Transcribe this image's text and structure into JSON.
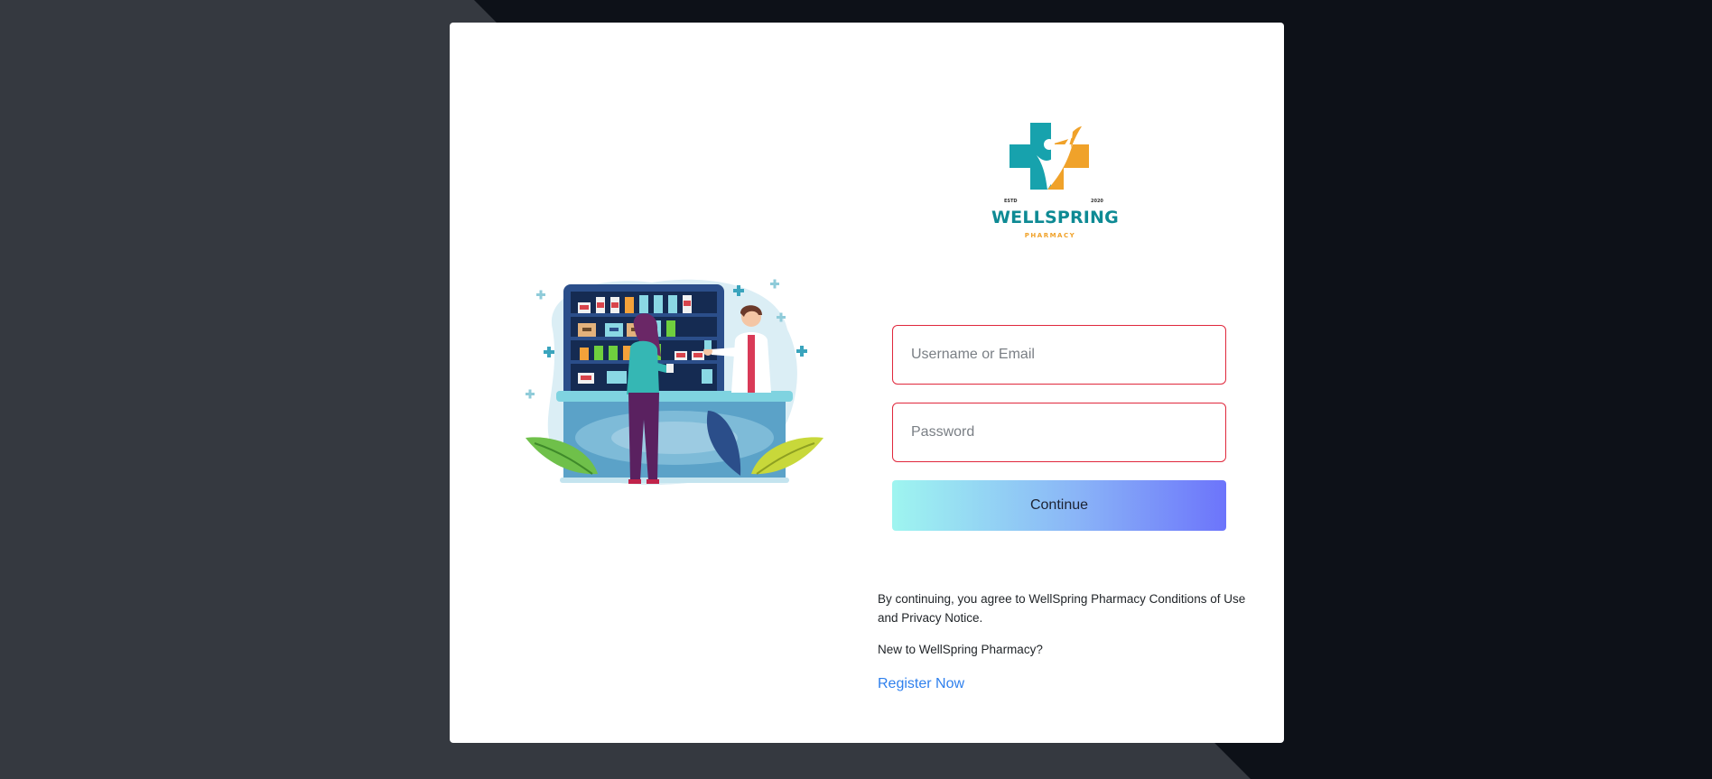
{
  "brand": {
    "name": "WELLSPRING",
    "sub": "PHARMACY",
    "estd_label": "ESTD",
    "year": "2020",
    "colors": {
      "teal": "#0e8a94",
      "orange": "#f0a22a"
    }
  },
  "form": {
    "username_placeholder": "Username or Email",
    "password_placeholder": "Password",
    "username_value": "",
    "password_value": "",
    "continue_label": "Continue",
    "field_border_color": "#e0283c",
    "button_gradient": [
      "#9ef5f0",
      "#8ab5f7",
      "#6c74fb"
    ]
  },
  "footer": {
    "terms_text": "By continuing, you agree to WellSpring Pharmacy Conditions of Use and Privacy Notice.",
    "new_user_text": "New to WellSpring Pharmacy?",
    "register_label": "Register Now",
    "link_color": "#2f80ed"
  },
  "icons": {
    "logo": "cross-person-logo-icon",
    "illustration": "pharmacy-counter-illustration-icon"
  }
}
